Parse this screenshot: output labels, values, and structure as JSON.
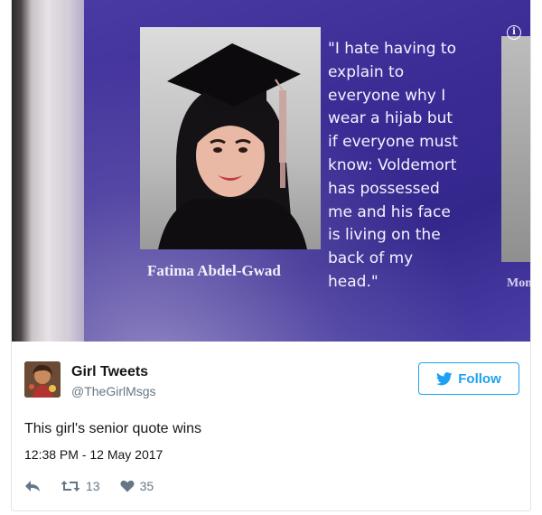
{
  "photo": {
    "quote_lines": [
      "\"I hate having to",
      "explain to",
      "everyone why I",
      "wear a hijab but",
      "if everyone must",
      "know: Voldemort",
      "has possessed",
      "me and his face",
      "is living on the",
      "back of my",
      "head.\""
    ],
    "caption_name": "Fatima Abdel-Gwad",
    "caption_next": "Mon",
    "info_badge": "i"
  },
  "author": {
    "display_name": "Girl Tweets",
    "username": "@TheGirlMsgs",
    "avatar_icon": "avatar-image"
  },
  "follow_button": {
    "label": "Follow",
    "icon": "twitter-bird-icon",
    "color": "#1da1f2"
  },
  "tweet": {
    "text": "This girl's senior quote wins",
    "timestamp": "12:38 PM - 12 May 2017"
  },
  "actions": {
    "reply_icon": "reply-icon",
    "retweet_icon": "retweet-icon",
    "retweet_count": "13",
    "like_icon": "heart-icon",
    "like_count": "35"
  }
}
